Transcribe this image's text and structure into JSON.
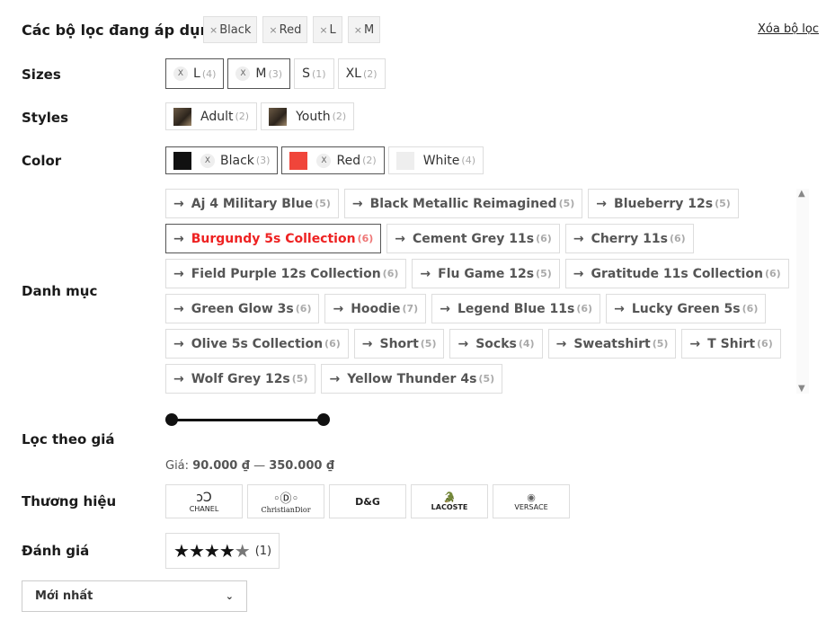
{
  "applied": {
    "title": "Các bộ lọc đang áp dụng",
    "chips": [
      "Black",
      "Red",
      "L",
      "M"
    ],
    "clear_label": "Xóa bộ lọc"
  },
  "sizes": {
    "label": "Sizes",
    "items": [
      {
        "name": "L",
        "count": "(4)",
        "active": true
      },
      {
        "name": "M",
        "count": "(3)",
        "active": true
      },
      {
        "name": "S",
        "count": "(1)",
        "active": false
      },
      {
        "name": "XL",
        "count": "(2)",
        "active": false
      }
    ]
  },
  "styles": {
    "label": "Styles",
    "items": [
      {
        "name": "Adult",
        "count": "(2)"
      },
      {
        "name": "Youth",
        "count": "(2)"
      }
    ]
  },
  "color": {
    "label": "Color",
    "items": [
      {
        "name": "Black",
        "count": "(3)",
        "swatch": "#111111",
        "active": true
      },
      {
        "name": "Red",
        "count": "(2)",
        "swatch": "#f0453a",
        "active": true
      },
      {
        "name": "White",
        "count": "(4)",
        "swatch": "#eeeeee",
        "active": false
      }
    ]
  },
  "category": {
    "label": "Danh mục",
    "items": [
      {
        "name": "Aj 4 Military Blue",
        "count": "(5)"
      },
      {
        "name": "Black Metallic Reimagined",
        "count": "(5)"
      },
      {
        "name": "Blueberry 12s",
        "count": "(5)"
      },
      {
        "name": "Burgundy 5s Collection",
        "count": "(6)",
        "active": true
      },
      {
        "name": "Cement Grey 11s",
        "count": "(6)"
      },
      {
        "name": "Cherry 11s",
        "count": "(6)"
      },
      {
        "name": "Field Purple 12s Collection",
        "count": "(6)"
      },
      {
        "name": "Flu Game 12s",
        "count": "(5)"
      },
      {
        "name": "Gratitude 11s Collection",
        "count": "(6)"
      },
      {
        "name": "Green Glow 3s",
        "count": "(6)"
      },
      {
        "name": "Hoodie",
        "count": "(7)"
      },
      {
        "name": "Legend Blue 11s",
        "count": "(6)"
      },
      {
        "name": "Lucky Green 5s",
        "count": "(6)"
      },
      {
        "name": "Olive 5s Collection",
        "count": "(6)"
      },
      {
        "name": "Short",
        "count": "(5)"
      },
      {
        "name": "Socks",
        "count": "(4)"
      },
      {
        "name": "Sweatshirt",
        "count": "(5)"
      },
      {
        "name": "T Shirt",
        "count": "(6)"
      },
      {
        "name": "Wolf Grey 12s",
        "count": "(5)"
      },
      {
        "name": "Yellow Thunder 4s",
        "count": "(5)"
      }
    ]
  },
  "price": {
    "label": "Lọc theo giá",
    "prefix": "Giá:",
    "min": "90.000 ₫",
    "sep": "—",
    "max": "350.000 ₫"
  },
  "brand": {
    "label": "Thương hiệu",
    "items": [
      "CHANEL",
      "ChristianDior",
      "D&G",
      "LACOSTE",
      "VERSACE"
    ]
  },
  "rating": {
    "label": "Đánh giá",
    "value": 4,
    "max": 5,
    "count": "(1)"
  },
  "sort": {
    "selected": "Mới nhất"
  },
  "colors": {
    "accent": "#e22222",
    "border": "#dddddd"
  }
}
